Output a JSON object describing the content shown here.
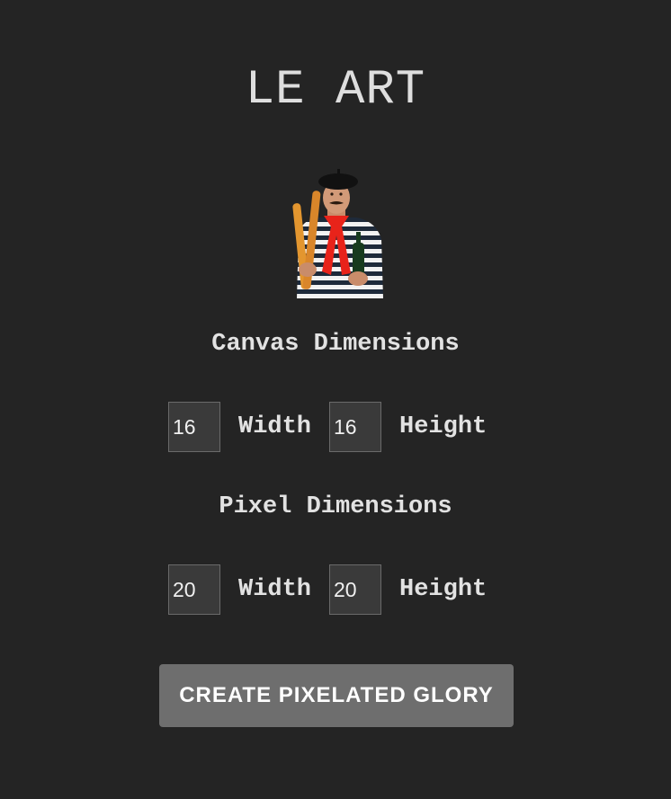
{
  "app": {
    "title": "LE ART"
  },
  "canvas": {
    "heading": "Canvas Dimensions",
    "width_value": "16",
    "width_label": "Width",
    "height_value": "16",
    "height_label": "Height"
  },
  "pixel": {
    "heading": "Pixel Dimensions",
    "width_value": "20",
    "width_label": "Width",
    "height_value": "20",
    "height_label": "Height"
  },
  "actions": {
    "create_label": "CREATE PIXELATED GLORY"
  },
  "colors": {
    "background": "#242424",
    "text": "#e2e2e2",
    "button": "#6e6e6e",
    "input_bg": "#3a3a3a"
  },
  "icons": {
    "mascot": "french-man-with-baguettes-image"
  }
}
